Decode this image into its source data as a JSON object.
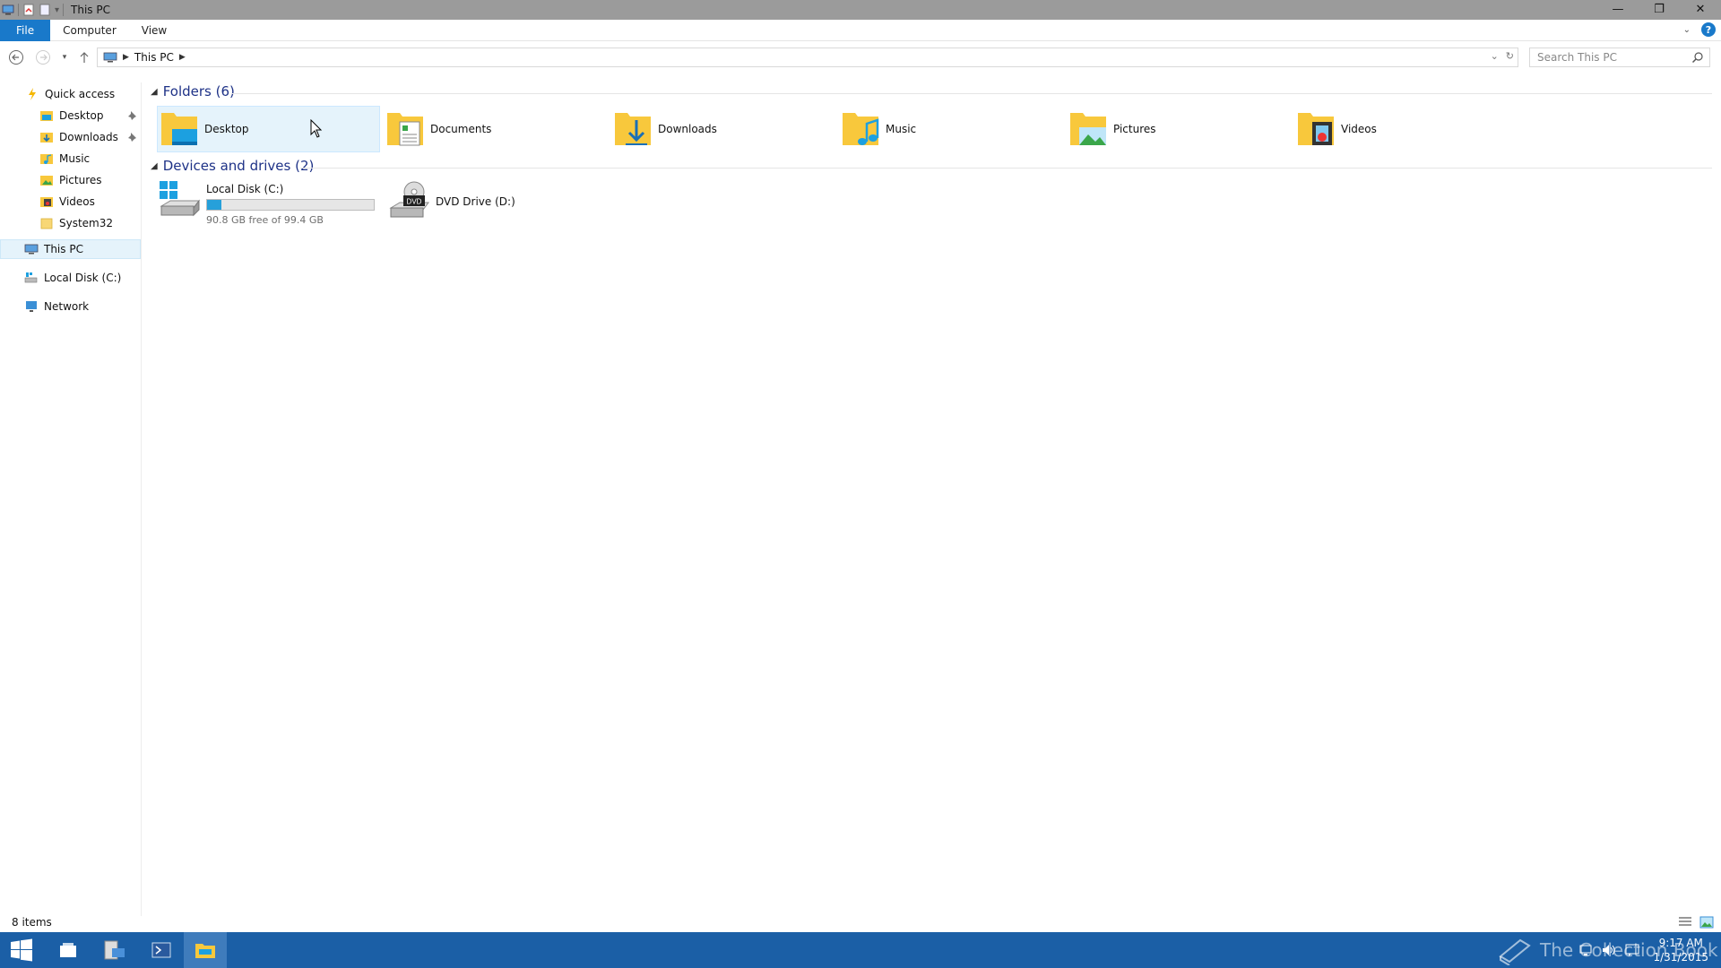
{
  "window": {
    "title": "This PC"
  },
  "ribbon": {
    "tabs": [
      "File",
      "Computer",
      "View"
    ]
  },
  "address_bar": {
    "breadcrumb": [
      "This PC"
    ]
  },
  "search": {
    "placeholder": "Search This PC"
  },
  "nav_pane": {
    "quick_access": "Quick access",
    "quick_items": [
      {
        "label": "Desktop",
        "pinned": true,
        "icon": "desktop-folder-icon"
      },
      {
        "label": "Downloads",
        "pinned": true,
        "icon": "downloads-folder-icon"
      },
      {
        "label": "Music",
        "pinned": false,
        "icon": "music-folder-icon"
      },
      {
        "label": "Pictures",
        "pinned": false,
        "icon": "pictures-folder-icon"
      },
      {
        "label": "Videos",
        "pinned": false,
        "icon": "videos-folder-icon"
      },
      {
        "label": "System32",
        "pinned": false,
        "icon": "folder-icon"
      }
    ],
    "this_pc": "This PC",
    "local_disk": "Local Disk (C:)",
    "network": "Network"
  },
  "folders_group": {
    "header": "Folders (6)",
    "items": [
      "Desktop",
      "Documents",
      "Downloads",
      "Music",
      "Pictures",
      "Videos"
    ]
  },
  "devices_group": {
    "header": "Devices and drives (2)",
    "local_disk": {
      "name": "Local Disk (C:)",
      "free": "90.8 GB free of 99.4 GB",
      "used_fraction": 0.087
    },
    "dvd": {
      "name": "DVD Drive (D:)",
      "badge": "DVD"
    }
  },
  "status": {
    "items_count": "8 items"
  },
  "taskbar": {
    "time": "9:17 AM",
    "date": "1/31/2015",
    "watermark": "The Collection Book"
  },
  "colors": {
    "accent": "#1979ca",
    "taskbar": "#1b5fa6",
    "folder_yellow": "#f8c83c",
    "bar_fill": "#26a0da"
  }
}
